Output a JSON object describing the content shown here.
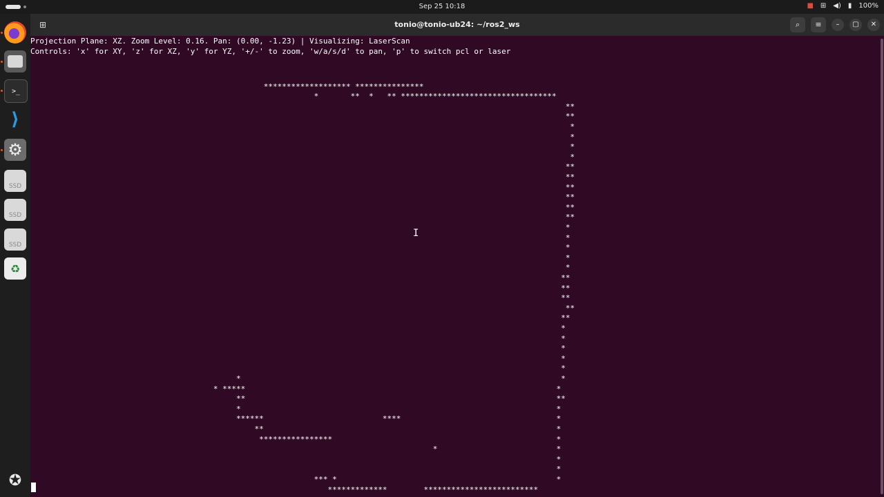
{
  "topbar": {
    "clock": "Sep 25  10:18",
    "battery": "100%",
    "tray_icons": [
      "screen-record-icon",
      "network-icon",
      "volume-icon",
      "battery-icon"
    ]
  },
  "dock": {
    "apps": [
      "firefox-icon",
      "files-icon",
      "terminal-icon",
      "vscode-icon",
      "settings-icon",
      "ssd-drive-icon",
      "ssd-drive-icon",
      "ssd-drive-icon",
      "trash-icon"
    ],
    "ssd_label": "SSD",
    "terminal_glyph": ">_",
    "show_apps_icon": "ubuntu-icon"
  },
  "window": {
    "title": "tonio@tonio-ub24: ~/ros2_ws",
    "buttons": [
      "new-tab-icon",
      "search-icon",
      "menu-icon",
      "minimize-icon",
      "maximize-icon",
      "close-icon"
    ]
  },
  "terminal": {
    "header1": "Projection Plane: XZ. Zoom Level: 0.16. Pan: (0.00, -1.23) | Visualizing: LaserScan",
    "header2": "Controls: 'x' for XY, 'z' for XZ, 'y' for YZ, '+/-' to zoom, 'w/a/s/d' to pan, 'p' to switch pcl or laser",
    "plot_lines": [
      "",
      "                                                   ******************* ***************",
      "                                                              *       **  *   ** **********************************",
      "                                                                                                                     **",
      "                                                                                                                     **",
      "                                                                                                                      *",
      "                                                                                                                      *",
      "                                                                                                                      *",
      "                                                                                                                      *",
      "                                                                                                                     **",
      "                                                                                                                     **",
      "                                                                                                                     **",
      "                                                                                                                     **",
      "                                                                                                                     **",
      "                                                                                                                     **",
      "                                                                                                                     *",
      "                                                                                                                     *",
      "                                                                                                                     *",
      "                                                                                                                     *",
      "                                                                                                                     *",
      "                                                                                                                    **",
      "                                                                                                                    **",
      "                                                                                                                    **",
      "                                                                                                                     **",
      "                                                                                                                    **",
      "                                                                                                                    *",
      "                                                                                                                    *",
      "                                                                                                                    *",
      "                                                                                                                    *",
      "                                                                                                                    *",
      "                                             *                                                                      *",
      "                                        * *****                                                                    *",
      "                                             **                                                                    **",
      "                                             *                                                                     *",
      "                                             ******                          ****                                  *",
      "                                                 **                                                                *",
      "                                                  ****************                                                 *",
      "                                                                                        *                          *",
      "                                                                                                                   *",
      "                                                                                                                   *",
      "                                                              *** *                                                *",
      "                                                                 *************        *************************"
    ]
  }
}
